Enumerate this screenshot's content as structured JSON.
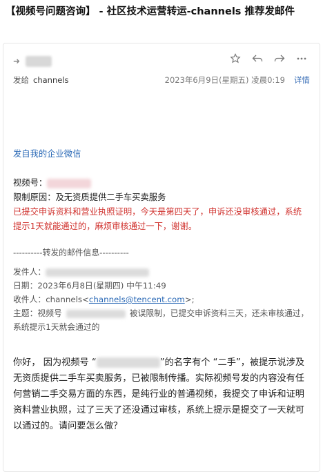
{
  "subject": "【视频号问题咨询】 - 社区技术运营转运-channels 推荐发邮件",
  "header": {
    "sender_arrow": "➜",
    "to_label": "发给",
    "to_name": "channels",
    "date": "2023年6月9日(星期五) 凌晨0:19",
    "detail_link": "详情"
  },
  "toolbar": {
    "icons": [
      "star-icon",
      "reply-icon",
      "forward-icon",
      "more-icon"
    ]
  },
  "body": {
    "from_wecom": "发自我的企业微信",
    "channel_label": "视频号：",
    "reason_label": "限制原因：",
    "reason_text": "及无资质提供二手车买卖服务",
    "red_line": "已提交申诉资料和营业执照证明，今天是第四天了，申诉还没审核通过，系统提示1天就能通过的，麻烦审核通过一下，谢谢。",
    "forward_divider": "----------转发的邮件信息----------",
    "fwd_from_label": "发件人：",
    "fwd_date": "日期：2023年6月8日(星期四) 中午11:49",
    "fwd_to_prefix": "收件人：channels<",
    "fwd_to_email": "channels@tencent.com",
    "fwd_to_suffix": ">;",
    "fwd_subject_prefix": "主题：视频号",
    "fwd_subject_suffix": "被误限制，已提交申诉资料三天，还未审核通过，系统提示1天就会通过的",
    "para_1a": "你好， 因为视频号 “",
    "para_1b": "”的名字有个 “二手”，被提示说涉及无资质提供二手车买卖服务，已被限制传播。实际视频号发的内容没有任何营销二手交易方面的东西，是纯行业的普通视频，我提交了申诉和证明资料营业执照，过了三天了还没通过审核，系统上提示是提交了一天就可以通过的。请问要怎么做？"
  }
}
